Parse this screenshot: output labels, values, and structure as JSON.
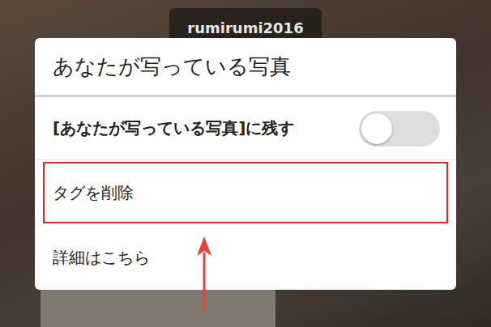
{
  "photo": {
    "username": "rumirumi2016"
  },
  "dialog": {
    "title": "あなたが写っている写真",
    "items": [
      {
        "kind": "toggle",
        "label": "[あなたが写っている写真]に残す",
        "on": false,
        "highlighted": false
      },
      {
        "kind": "action",
        "label": "タグを削除",
        "highlighted": true
      },
      {
        "kind": "action",
        "label": "詳細はこちら",
        "highlighted": false
      }
    ]
  },
  "annotation": {
    "arrow": true
  }
}
